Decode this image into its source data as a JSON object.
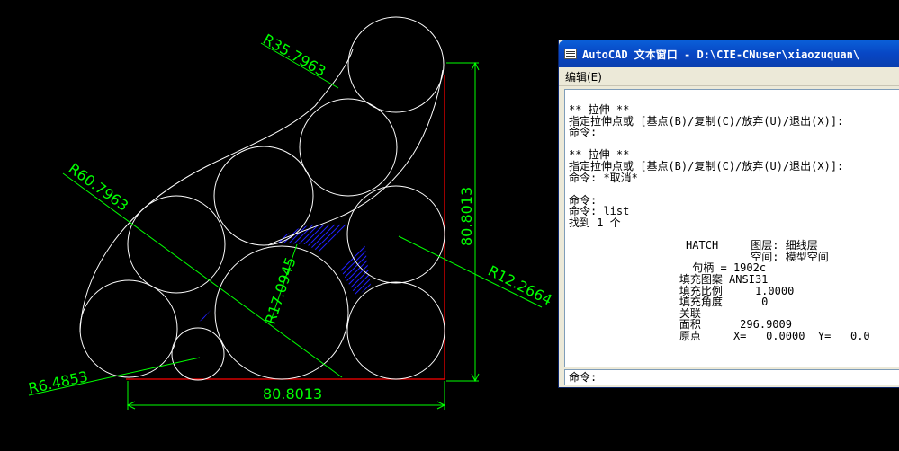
{
  "drawing": {
    "dimensions": {
      "r_top": "R35.7963",
      "r_big_arc": "R60.7963",
      "r_right": "R12.2664",
      "r_small": "R6.4853",
      "r_center": "R17.0945",
      "height": "80.8013",
      "width": "80.8013"
    },
    "colors": {
      "geometry": "#ffffff",
      "dimension": "#00ff00",
      "edge": "#ff0000",
      "hatch": "#0000ff"
    }
  },
  "text_window": {
    "title": "AutoCAD 文本窗口 - D:\\CIE-CNuser\\xiaozuquan\\",
    "menu": {
      "edit": "编辑(E)"
    },
    "lines": [
      "** 拉伸 **",
      "指定拉伸点或 [基点(B)/复制(C)/放弃(U)/退出(X)]:",
      "命令:",
      "",
      "** 拉伸 **",
      "指定拉伸点或 [基点(B)/复制(C)/放弃(U)/退出(X)]:",
      "命令: *取消*",
      "",
      "命令:",
      "命令: list",
      "找到 1 个",
      "",
      "                  HATCH     图层: 细线层",
      "                            空间: 模型空间",
      "                   句柄 = 1902c",
      "                 填充图案 ANSI31",
      "                 填充比例     1.0000",
      "                 填充角度      0",
      "                 关联",
      "                 面积      296.9009",
      "                 原点     X=   0.0000  Y=   0.0"
    ],
    "prompt": "命令:"
  }
}
